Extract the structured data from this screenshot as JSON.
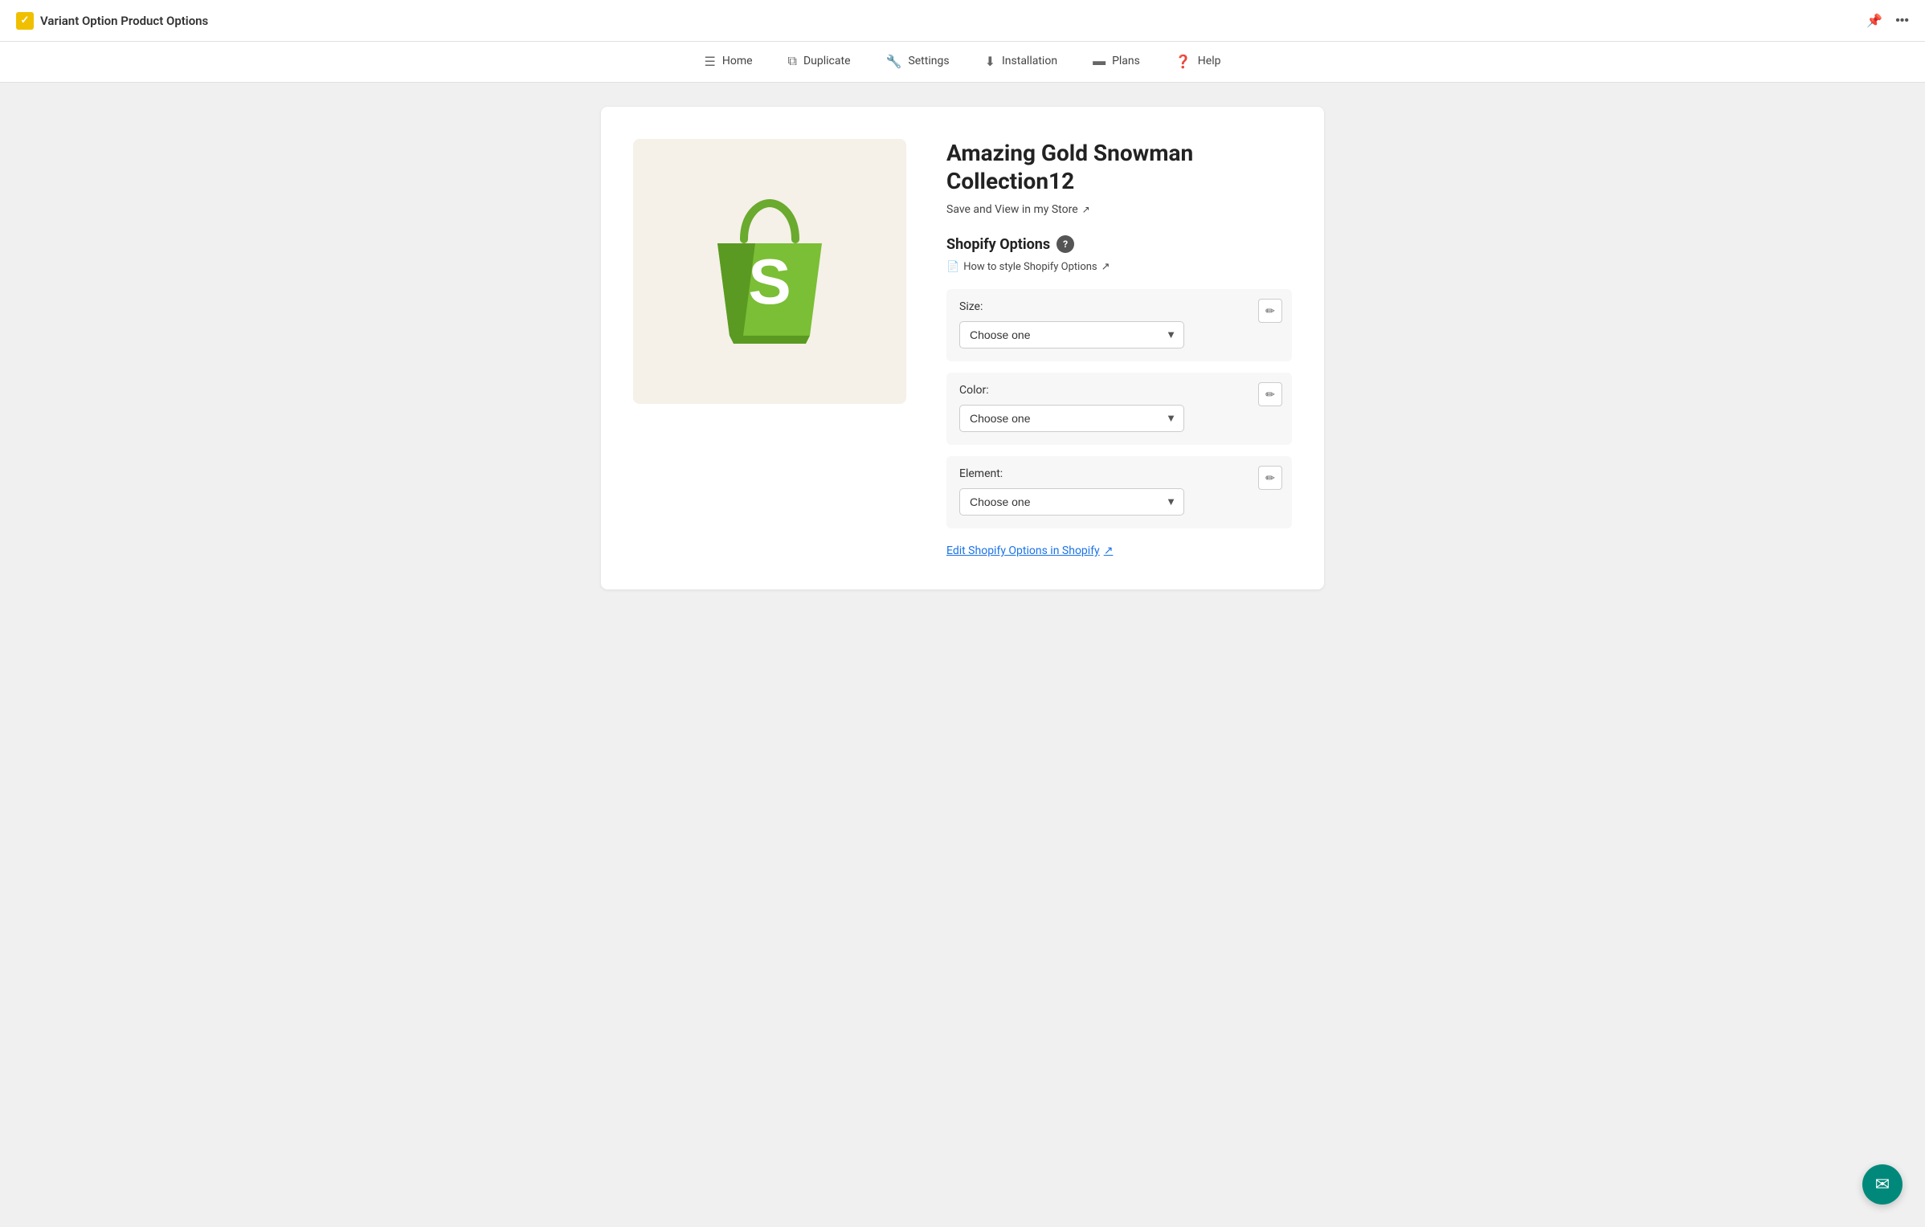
{
  "app": {
    "title": "Variant Option Product Options",
    "brand_icon": "checkmark",
    "pin_icon": "📌",
    "more_icon": "⋯"
  },
  "nav": {
    "items": [
      {
        "label": "Home",
        "icon": "☰"
      },
      {
        "label": "Duplicate",
        "icon": "⧉"
      },
      {
        "label": "Settings",
        "icon": "🔧"
      },
      {
        "label": "Installation",
        "icon": "⬇"
      },
      {
        "label": "Plans",
        "icon": "▬"
      },
      {
        "label": "Help",
        "icon": "❓"
      }
    ]
  },
  "product": {
    "title": "Amazing Gold Snowman Collection12",
    "save_link_text": "Save and View in my Store",
    "save_link_ext": "↗",
    "section_title": "Shopify Options",
    "style_link_text": "How to style Shopify Options",
    "style_link_icon": "📄",
    "style_link_ext": "↗",
    "options": [
      {
        "label": "Size:",
        "placeholder": "Choose one"
      },
      {
        "label": "Color:",
        "placeholder": "Choose one"
      },
      {
        "label": "Element:",
        "placeholder": "Choose one"
      }
    ],
    "edit_shopify_label": "Edit Shopify Options in Shopify",
    "edit_shopify_ext": "↗"
  },
  "chat_icon": "✉"
}
